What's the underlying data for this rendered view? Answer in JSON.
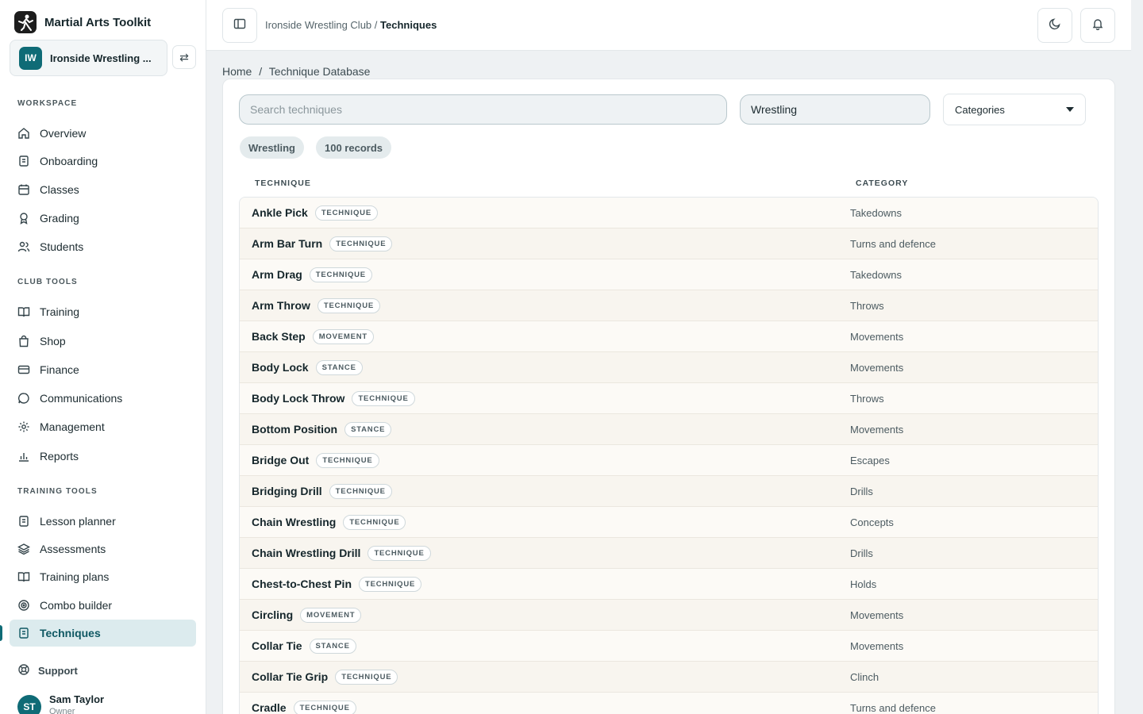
{
  "app": {
    "name": "Martial Arts Toolkit"
  },
  "club": {
    "initials": "IW",
    "name": "Ironside Wrestling ..."
  },
  "sections": {
    "workspace": "WORKSPACE",
    "club_tools": "CLUB TOOLS",
    "training_tools": "TRAINING TOOLS"
  },
  "nav": {
    "overview": "Overview",
    "onboarding": "Onboarding",
    "classes": "Classes",
    "grading": "Grading",
    "students": "Students",
    "training": "Training",
    "shop": "Shop",
    "finance": "Finance",
    "communications": "Communications",
    "management": "Management",
    "reports": "Reports",
    "lesson_planner": "Lesson planner",
    "assessments": "Assessments",
    "training_plans": "Training plans",
    "combo_builder": "Combo builder",
    "techniques": "Techniques"
  },
  "support": "Support",
  "user": {
    "initials": "ST",
    "name": "Sam Taylor",
    "role": "Owner"
  },
  "topbar": {
    "crumb_club": "Ironside Wrestling Club",
    "crumb_sep": "/",
    "crumb_page": "Techniques"
  },
  "breadcrumb": {
    "home": "Home",
    "sep": "/",
    "page": "Technique Database"
  },
  "filters": {
    "search_placeholder": "Search techniques",
    "discipline_value": "Wrestling",
    "categories_label": "Categories"
  },
  "chips": {
    "discipline": "Wrestling",
    "records": "100 records"
  },
  "columns": {
    "technique": "TECHNIQUE",
    "category": "CATEGORY"
  },
  "rows": [
    {
      "name": "Ankle Pick",
      "type": "TECHNIQUE",
      "category": "Takedowns"
    },
    {
      "name": "Arm Bar Turn",
      "type": "TECHNIQUE",
      "category": "Turns and defence"
    },
    {
      "name": "Arm Drag",
      "type": "TECHNIQUE",
      "category": "Takedowns"
    },
    {
      "name": "Arm Throw",
      "type": "TECHNIQUE",
      "category": "Throws"
    },
    {
      "name": "Back Step",
      "type": "MOVEMENT",
      "category": "Movements"
    },
    {
      "name": "Body Lock",
      "type": "STANCE",
      "category": "Movements"
    },
    {
      "name": "Body Lock Throw",
      "type": "TECHNIQUE",
      "category": "Throws"
    },
    {
      "name": "Bottom Position",
      "type": "STANCE",
      "category": "Movements"
    },
    {
      "name": "Bridge Out",
      "type": "TECHNIQUE",
      "category": "Escapes"
    },
    {
      "name": "Bridging Drill",
      "type": "TECHNIQUE",
      "category": "Drills"
    },
    {
      "name": "Chain Wrestling",
      "type": "TECHNIQUE",
      "category": "Concepts"
    },
    {
      "name": "Chain Wrestling Drill",
      "type": "TECHNIQUE",
      "category": "Drills"
    },
    {
      "name": "Chest-to-Chest Pin",
      "type": "TECHNIQUE",
      "category": "Holds"
    },
    {
      "name": "Circling",
      "type": "MOVEMENT",
      "category": "Movements"
    },
    {
      "name": "Collar Tie",
      "type": "STANCE",
      "category": "Movements"
    },
    {
      "name": "Collar Tie Grip",
      "type": "TECHNIQUE",
      "category": "Clinch"
    },
    {
      "name": "Cradle",
      "type": "TECHNIQUE",
      "category": "Turns and defence"
    }
  ]
}
